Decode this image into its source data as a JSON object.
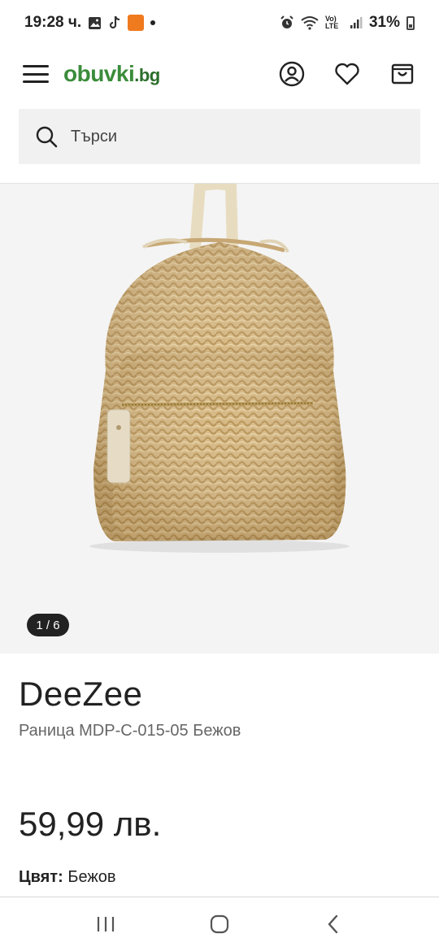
{
  "status_bar": {
    "time": "19:28 ч.",
    "battery": "31%",
    "network_label": "Vo) LTE",
    "icons": [
      "gallery-icon",
      "tiktok-icon",
      "temu-icon",
      "notification-dot-icon",
      "alarm-icon",
      "wifi-icon",
      "signal-icon",
      "battery-icon"
    ]
  },
  "header": {
    "logo_main": "obuvki",
    "logo_tld": ".bg",
    "icons": [
      "menu-icon",
      "account-icon",
      "heart-icon",
      "cart-icon"
    ]
  },
  "search": {
    "placeholder": "Търси"
  },
  "gallery": {
    "counter": "1 / 6",
    "image_subject": "straw backpack"
  },
  "product": {
    "brand": "DeeZee",
    "name": "Раница MDP-C-015-05 Бежов",
    "price": "59,99 лв.",
    "color_label": "Цвят:",
    "color_value": "Бежов"
  },
  "colors": {
    "brand_green": "#3a8c3a",
    "search_bg": "#f1f1f1",
    "gallery_bg": "#f4f4f4",
    "straw": "#d2b27c"
  },
  "navbar": {
    "icons": [
      "recent-apps-icon",
      "home-icon",
      "back-icon"
    ]
  }
}
